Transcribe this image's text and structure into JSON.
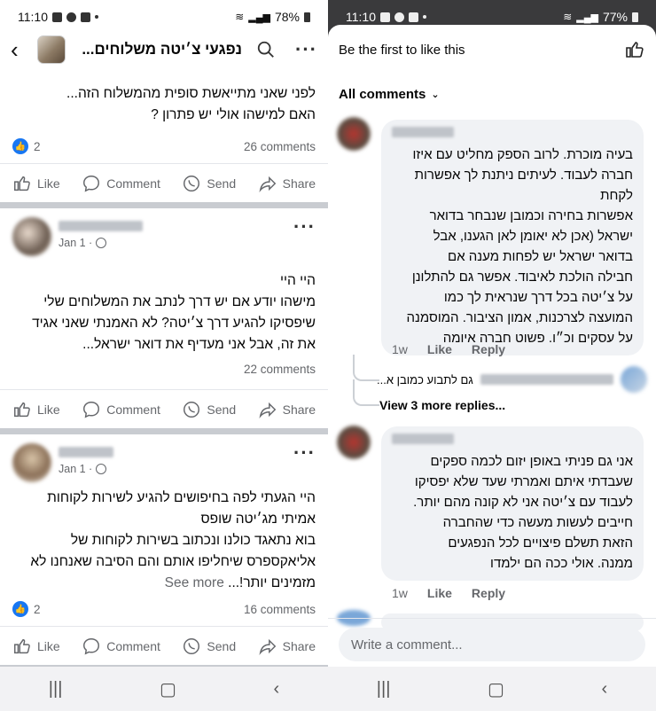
{
  "left": {
    "status": {
      "time": "11:10",
      "battery": "78%"
    },
    "topbar": {
      "title": "נפגעי צ׳יטה משלוחים..."
    },
    "post1": {
      "text": [
        "לפני שאני מתייאשת סופית מהמשלוח הזה...",
        "האם למישהו אולי יש פתרון ?"
      ],
      "likes": "2",
      "comments": "26 comments"
    },
    "actions": {
      "like": "Like",
      "comment": "Comment",
      "send": "Send",
      "share": "Share"
    },
    "post2": {
      "date": "Jan 1 ·",
      "text": [
        "היי היי",
        "מישהו יודע אם יש דרך לנתב את המשלוחים שלי",
        "שיפסיקו להגיע דרך צ׳יטה? לא האמנתי שאני אגיד",
        "את זה, אבל אני מעדיף את דואר ישראל..."
      ],
      "comments": "22 comments"
    },
    "post3": {
      "date": "Jan 1 ·",
      "text": [
        "היי הגעתי לפה בחיפושים להגיע לשירות לקוחות",
        "אמיתי מג׳יטה שופס",
        "בוא נתאגד כולנו ונכתוב בשירות לקוחות של",
        "אליאקספרס שיחליפו אותם והם הסיבה שאנחנו לא"
      ],
      "last_line": "מזמינים יותר!...",
      "see_more": "See more",
      "likes": "2",
      "comments": "16 comments"
    }
  },
  "right": {
    "status": {
      "time": "11:10",
      "battery": "77%"
    },
    "first_like": "Be the first to like this",
    "all_comments": "All comments",
    "comment1": {
      "text": [
        "בעיה מוכרת. לרוב הספק מחליט עם איזו",
        "חברה לעבוד. לעיתים ניתנת לך אפשרות לקחת",
        "אפשרות בחירה וכמובן שנבחר בדואר",
        "ישראל (אכן לא יאומן לאן הגענו, אבל",
        "בדואר ישראל יש לפחות מענה אם",
        "חבילה הולכת לאיבוד. אפשר גם להתלונן",
        "על צ׳יטה בכל דרך שנראית לך כמו",
        "המועצה לצרכנות, אמון הציבור. המוסמנה",
        "על עסקים וכ״ו. פשוט חברה איומה"
      ],
      "age": "1w",
      "like": "Like",
      "reply": "Reply"
    },
    "reply_preview": "גם לתבוע כמובן א...",
    "view_more": "View 3 more replies...",
    "comment2": {
      "text": [
        "אני גם פניתי באופן יזום לכמה ספקים",
        "שעבדתי איתם ואמרתי שעד שלא יפסיקו",
        "לעבוד עם צ׳יטה אני לא קונה מהם יותר.",
        "חייבים לעשות מעשה כדי שהחברה",
        "הזאת תשלם פיצויים לכל הנפגעים",
        "ממנה. אולי ככה הם ילמדו"
      ],
      "age": "1w",
      "like": "Like",
      "reply": "Reply"
    },
    "write_placeholder": "Write a comment..."
  }
}
